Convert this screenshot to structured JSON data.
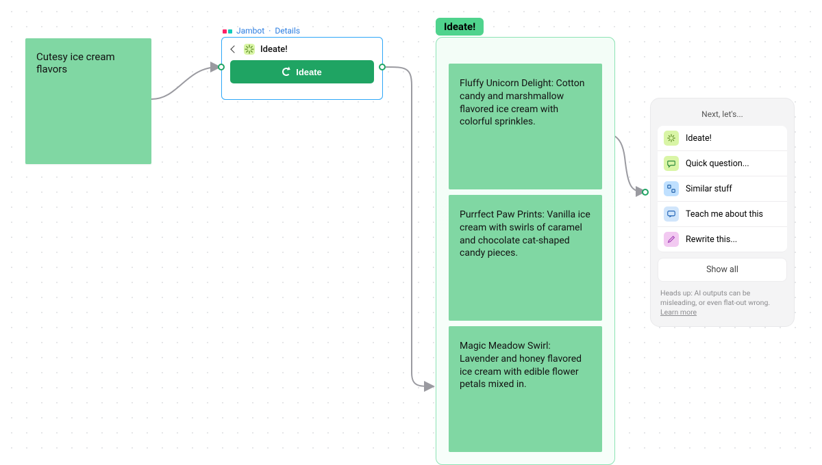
{
  "sticky": {
    "text": "Cutesy ice cream flavors"
  },
  "widget": {
    "brand": "Jambot",
    "details_label": "Details",
    "title": "Ideate!",
    "button_label": "Ideate"
  },
  "results": {
    "badge": "Ideate!",
    "cards": [
      "Fluffy Unicorn Delight: Cotton candy and marshmallow flavored ice cream with colorful sprinkles.",
      "Purrfect Paw Prints: Vanilla ice cream with swirls of caramel and chocolate cat-shaped candy pieces.",
      "Magic Meadow Swirl: Lavender and honey flavored ice cream with edible flower petals mixed in."
    ]
  },
  "next": {
    "title": "Next, let's...",
    "items": [
      {
        "label": "Ideate!",
        "icon": "ideate"
      },
      {
        "label": "Quick question...",
        "icon": "question"
      },
      {
        "label": "Similar stuff",
        "icon": "similar"
      },
      {
        "label": "Teach me about this",
        "icon": "teach"
      },
      {
        "label": "Rewrite this...",
        "icon": "rewrite"
      }
    ],
    "show_all": "Show all",
    "disclaimer": "Heads up: AI outputs can be misleading, or even flat-out wrong.",
    "learn_more": "Learn more"
  }
}
